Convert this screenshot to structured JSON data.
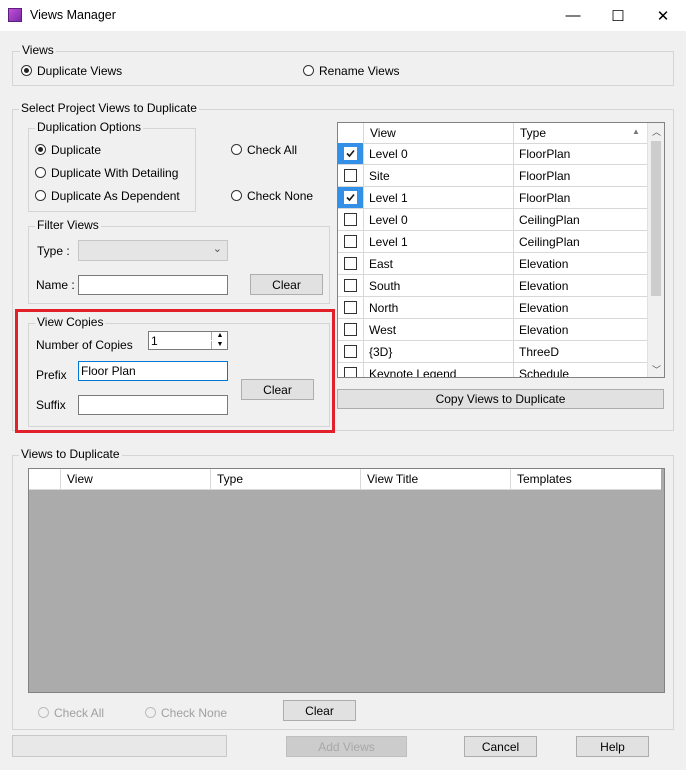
{
  "window": {
    "title": "Views Manager",
    "minimize": "—",
    "maximize": "☐",
    "close": "✕"
  },
  "mode": {
    "legend": "Views",
    "duplicate_label": "Duplicate Views",
    "rename_label": "Rename Views",
    "selected": "duplicate"
  },
  "select_group": {
    "legend": "Select Project Views to Duplicate",
    "options_legend": "Duplication Options",
    "opt_duplicate": "Duplicate",
    "opt_with_detailing": "Duplicate With Detailing",
    "opt_as_dependent": "Duplicate As Dependent",
    "check_all": "Check All",
    "check_none": "Check None",
    "filter_legend": "Filter Views",
    "type_label": "Type :",
    "type_value": "",
    "name_label": "Name :",
    "name_value": "",
    "filter_clear": "Clear",
    "copies_legend": "View Copies",
    "number_label": "Number of Copies",
    "number_value": "1",
    "prefix_label": "Prefix",
    "prefix_value": "Floor Plan",
    "suffix_label": "Suffix",
    "suffix_value": "",
    "copies_clear": "Clear",
    "copy_button": "Copy Views to Duplicate"
  },
  "project_views": {
    "col_view": "View",
    "col_type": "Type",
    "rows": [
      {
        "view": "Level 0",
        "type": "FloorPlan",
        "checked": true
      },
      {
        "view": "Site",
        "type": "FloorPlan",
        "checked": false
      },
      {
        "view": "Level 1",
        "type": "FloorPlan",
        "checked": true
      },
      {
        "view": "Level 0",
        "type": "CeilingPlan",
        "checked": false
      },
      {
        "view": "Level 1",
        "type": "CeilingPlan",
        "checked": false
      },
      {
        "view": "East",
        "type": "Elevation",
        "checked": false
      },
      {
        "view": "South",
        "type": "Elevation",
        "checked": false
      },
      {
        "view": "North",
        "type": "Elevation",
        "checked": false
      },
      {
        "view": "West",
        "type": "Elevation",
        "checked": false
      },
      {
        "view": "{3D}",
        "type": "ThreeD",
        "checked": false
      },
      {
        "view": "Keynote Legend",
        "type": "Schedule",
        "checked": false
      }
    ]
  },
  "to_duplicate": {
    "legend": "Views to Duplicate",
    "col_view": "View",
    "col_type": "Type",
    "col_title": "View Title",
    "col_templates": "Templates",
    "check_all": "Check All",
    "check_none": "Check None",
    "clear": "Clear"
  },
  "footer": {
    "add_views": "Add Views",
    "cancel": "Cancel",
    "help": "Help"
  }
}
